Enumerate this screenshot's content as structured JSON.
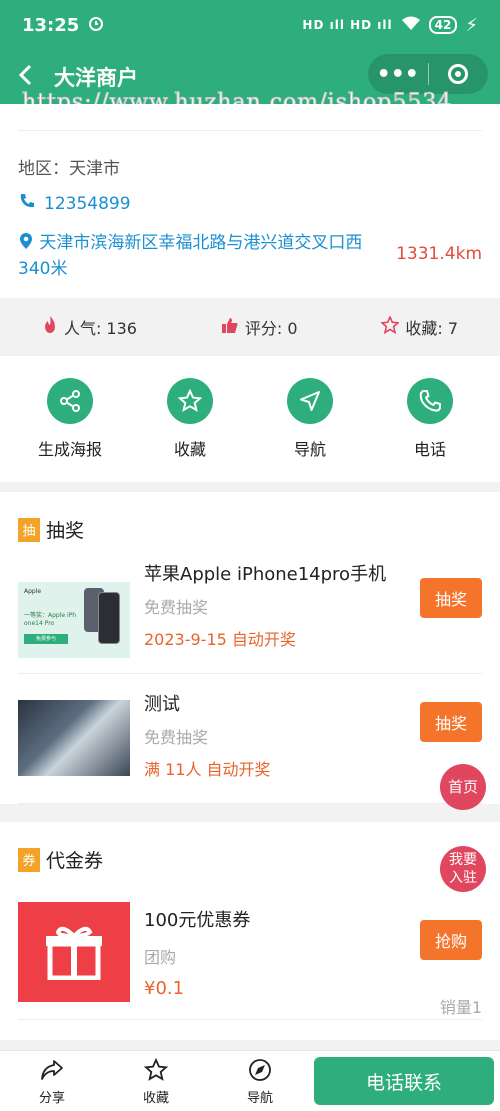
{
  "status_bar": {
    "time": "13:25",
    "signal": "HD ıll HD ıll",
    "battery": "42"
  },
  "navbar": {
    "back_icon": "chevron-left-icon",
    "title": "大洋商户",
    "more_icon": "ellipsis-icon",
    "target_icon": "target-icon"
  },
  "watermark": "https://www.huzhan.com/ishop5534",
  "shop": {
    "region": "地区：天津市",
    "phone": "12354899",
    "address": "天津市滨海新区幸福北路与港兴道交叉口西340米",
    "distance": "1331.4km"
  },
  "stats": [
    {
      "icon": "flame-icon",
      "label": "人气: 136"
    },
    {
      "icon": "thumbs-up-icon",
      "label": "评分: 0"
    },
    {
      "icon": "star-outline-icon",
      "label": "收藏: 7"
    }
  ],
  "actions": [
    {
      "icon": "share-icon",
      "label": "生成海报"
    },
    {
      "icon": "star-icon",
      "label": "收藏"
    },
    {
      "icon": "navigation-icon",
      "label": "导航"
    },
    {
      "icon": "phone-icon",
      "label": "电话"
    }
  ],
  "lottery": {
    "tag": "抽",
    "title": "抽奖",
    "items": [
      {
        "title": "苹果Apple iPhone14pro手机",
        "sub": "免费抽奖",
        "meta": "2023-9-15 自动开奖",
        "button": "抽奖",
        "thumb_text_1": "Apple",
        "thumb_text_2": "一等奖：Apple iPh one14 Pro",
        "thumb_text_3": "免费参与"
      },
      {
        "title": "测试",
        "sub": "免费抽奖",
        "meta": "满 11人 自动开奖",
        "button": "抽奖"
      }
    ]
  },
  "coupon": {
    "tag": "券",
    "title": "代金券",
    "items": [
      {
        "title": "100元优惠券",
        "sub": "团购",
        "price": "¥0.1",
        "button": "抢购",
        "sales": "销量1"
      }
    ]
  },
  "float_buttons": {
    "home": "首页",
    "join": "我要入驻"
  },
  "bottom_bar": {
    "tabs": [
      {
        "icon": "share-arrow-icon",
        "label": "分享"
      },
      {
        "icon": "star-outline-icon",
        "label": "收藏"
      },
      {
        "icon": "compass-icon",
        "label": "导航"
      }
    ],
    "call_button": "电话联系"
  },
  "colors": {
    "primary": "#2fae7d",
    "accent_orange": "#f5742c",
    "link_blue": "#1b8fd1",
    "float_red": "#e0475e"
  }
}
